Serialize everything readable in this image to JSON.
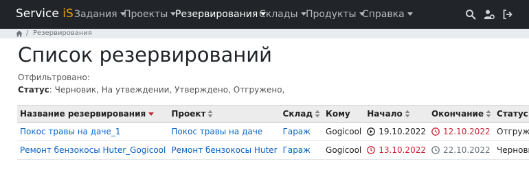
{
  "navbar": {
    "brand_main": "Service ",
    "brand_accent": "iS",
    "items": [
      {
        "label": "Задания"
      },
      {
        "label": "Проекты"
      },
      {
        "label": "Резервирования"
      },
      {
        "label": "Склады"
      },
      {
        "label": "Продукты"
      },
      {
        "label": "Справка"
      }
    ],
    "icons": [
      "search-icon",
      "user-settings-icon",
      "logout-icon"
    ],
    "colors": {
      "bg": "#212529",
      "accent": "#e8a200"
    }
  },
  "breadcrumb": {
    "current": "Резервирования",
    "separator": "/"
  },
  "page": {
    "title": "Список резервирований",
    "filtered_label": "Отфильтровано:",
    "status_key": "Статус",
    "status_values": ": Черновик, На утвеждении, Утверждено, Отгружено,"
  },
  "table": {
    "headers": [
      "Название резервирования",
      "Проект",
      "Склад",
      "Кому",
      "Начало",
      "Окончание",
      "Статус"
    ],
    "rows": [
      {
        "name": "Покос травы на даче_1",
        "project": "Покос травы на даче",
        "warehouse": "Гараж",
        "to": "Gogicool",
        "start": "19.10.2022",
        "end": "12.10.2022",
        "status": "Отгружено"
      },
      {
        "name": "Ремонт бензокосы Huter_Gogicool",
        "project": "Ремонт бензокосы Huter",
        "warehouse": "Гараж",
        "to": "Gogicool",
        "start": "13.10.2022",
        "end": "22.10.2022",
        "status": "Черновик"
      }
    ]
  }
}
